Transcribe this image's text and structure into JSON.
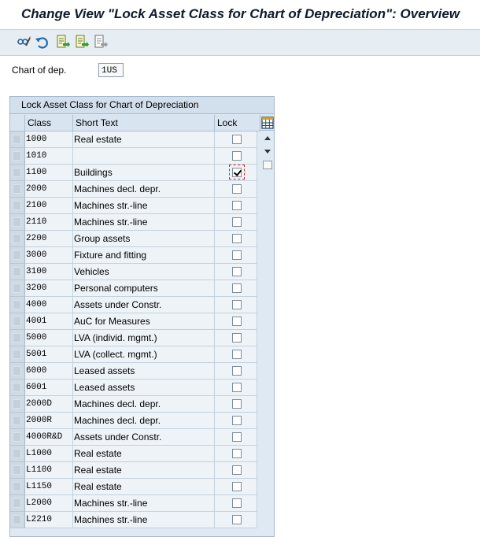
{
  "window": {
    "title": "Change View \"Lock Asset Class for Chart of Depreciation\": Overview"
  },
  "toolbar": {
    "buttons": [
      {
        "icon": "display-change-icon"
      },
      {
        "icon": "undo-icon"
      },
      {
        "icon": "export-icon"
      },
      {
        "icon": "select-all-icon"
      },
      {
        "icon": "deselect-all-icon"
      }
    ]
  },
  "selection": {
    "label": "Chart of dep.",
    "value": "1US"
  },
  "table": {
    "title": "Lock Asset Class for Chart of Depreciation",
    "columns": {
      "class": "Class",
      "short_text": "Short Text",
      "lock": "Lock"
    },
    "rows": [
      {
        "class": "1000",
        "text": "Real estate",
        "lock": false
      },
      {
        "class": "1010",
        "text": "",
        "lock": false
      },
      {
        "class": "1100",
        "text": "Buildings",
        "lock": true,
        "focused": true
      },
      {
        "class": "2000",
        "text": "Machines decl. depr.",
        "lock": false
      },
      {
        "class": "2100",
        "text": "Machines str.-line",
        "lock": false
      },
      {
        "class": "2110",
        "text": "Machines str.-line",
        "lock": false
      },
      {
        "class": "2200",
        "text": "Group assets",
        "lock": false
      },
      {
        "class": "3000",
        "text": "Fixture and fitting",
        "lock": false
      },
      {
        "class": "3100",
        "text": "Vehicles",
        "lock": false
      },
      {
        "class": "3200",
        "text": "Personal computers",
        "lock": false
      },
      {
        "class": "4000",
        "text": "Assets under Constr.",
        "lock": false
      },
      {
        "class": "4001",
        "text": "AuC for Measures",
        "lock": false
      },
      {
        "class": "5000",
        "text": "LVA (individ. mgmt.)",
        "lock": false
      },
      {
        "class": "5001",
        "text": "LVA (collect. mgmt.)",
        "lock": false
      },
      {
        "class": "6000",
        "text": "Leased assets",
        "lock": false
      },
      {
        "class": "6001",
        "text": "Leased assets",
        "lock": false
      },
      {
        "class": "2000D",
        "text": "Machines decl. depr.",
        "lock": false
      },
      {
        "class": "2000R",
        "text": "Machines decl. depr.",
        "lock": false
      },
      {
        "class": "4000R&D",
        "text": "Assets under Constr.",
        "lock": false
      },
      {
        "class": "L1000",
        "text": "Real estate",
        "lock": false
      },
      {
        "class": "L1100",
        "text": "Real estate",
        "lock": false
      },
      {
        "class": "L1150",
        "text": "Real estate",
        "lock": false
      },
      {
        "class": "L2000",
        "text": "Machines str.-line",
        "lock": false
      },
      {
        "class": "L2210",
        "text": "Machines str.-line",
        "lock": false
      }
    ]
  }
}
